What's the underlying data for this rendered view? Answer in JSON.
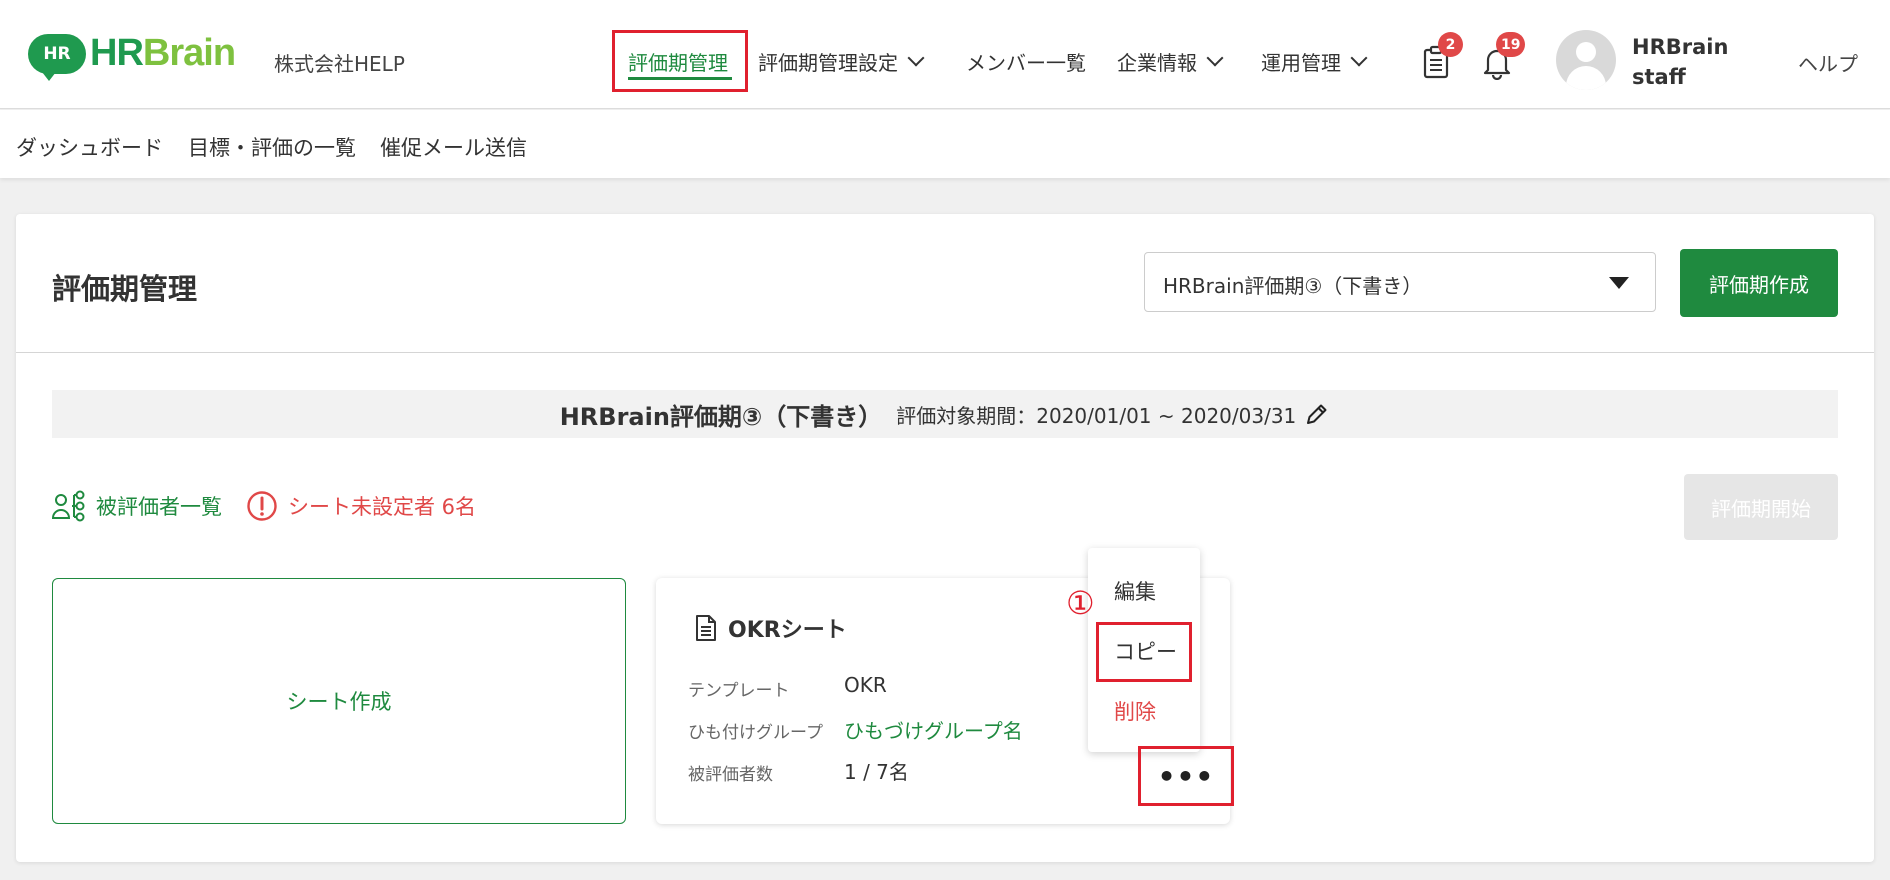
{
  "header": {
    "logo_mark": "HR",
    "logo_hr": "HR",
    "logo_brain": "Brain",
    "company": "株式会社HELP",
    "nav": [
      {
        "label": "評価期管理"
      },
      {
        "label": "評価期管理設定"
      },
      {
        "label": "メンバー一覧"
      },
      {
        "label": "企業情報"
      },
      {
        "label": "運用管理"
      }
    ],
    "task_badge": "2",
    "notification_badge": "19",
    "user_line1": "HRBrain",
    "user_line2": "staff",
    "help": "ヘルプ"
  },
  "subnav": [
    "ダッシュボード",
    "目標・評価の一覧",
    "催促メール送信"
  ],
  "page": {
    "title": "評価期管理",
    "period_select_value": "HRBrain評価期③（下書き）",
    "create_period_button": "評価期作成",
    "period_name": "HRBrain評価期③（下書き）",
    "period_range": "評価対象期間：2020/01/01 ~ 2020/03/31",
    "evaluatee_list_link": "被評価者一覧",
    "unset_warning": "シート未設定者 6名",
    "start_period_button": "評価期開始",
    "create_sheet": "シート作成"
  },
  "sheet": {
    "title": "OKRシート",
    "template_label": "テンプレート",
    "template_value": "OKR",
    "group_label": "ひも付けグループ",
    "group_value": "ひもづけグループ名",
    "count_label": "被評価者数",
    "count_value": "1 / 7名",
    "more_label": "•••"
  },
  "context_menu": {
    "edit": "編集",
    "copy": "コピー",
    "delete": "削除"
  },
  "annotation": {
    "step": "①"
  },
  "colors": {
    "brand_green": "#1f8a3f",
    "logo_light_green": "#7ec13f",
    "danger": "#e04848",
    "highlight": "#e0202e"
  }
}
